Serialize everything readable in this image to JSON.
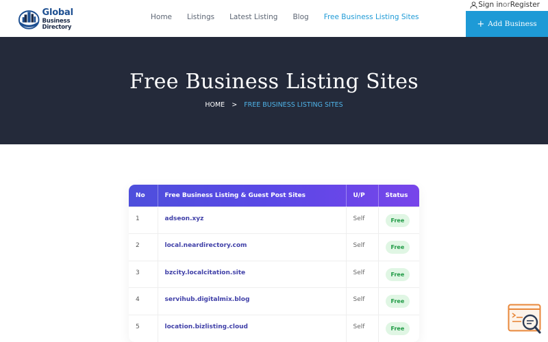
{
  "logo": {
    "line1": "Global",
    "line2": "Business Directory",
    "brand_color": "#1d4f91"
  },
  "nav": {
    "items": [
      {
        "label": "Home",
        "active": false
      },
      {
        "label": "Listings",
        "active": false
      },
      {
        "label": "Latest Listing",
        "active": false
      },
      {
        "label": "Blog",
        "active": false
      },
      {
        "label": "Free Business Listing Sites",
        "active": true
      }
    ],
    "active_color": "#1e9ad6"
  },
  "auth": {
    "sign_in": "Sign in",
    "or": "or",
    "register": "Register",
    "icon": "user-icon"
  },
  "add_business": {
    "icon": "+",
    "label": "Add Business",
    "bg_color": "#1e9ad6"
  },
  "hero": {
    "title": "Free Business Listing Sites",
    "breadcrumb": {
      "home": "HOME",
      "separator": ">",
      "current": "FREE BUSINESS LISTING SITES"
    },
    "bg_color": "#242a3a"
  },
  "table": {
    "headers": [
      "No",
      "Free Business Listing & Guest Post Sites",
      "U/P",
      "Status"
    ],
    "rows": [
      {
        "no": "1",
        "site": "adseon.xyz",
        "up": "Self",
        "status": "Free"
      },
      {
        "no": "2",
        "site": "local.neardirectory.com",
        "up": "Self",
        "status": "Free"
      },
      {
        "no": "3",
        "site": "bzcity.localcitation.site",
        "up": "Self",
        "status": "Free"
      },
      {
        "no": "4",
        "site": "servihub.digitalmix.blog",
        "up": "Self",
        "status": "Free"
      },
      {
        "no": "5",
        "site": "location.bizlisting.cloud",
        "up": "Self",
        "status": "Free"
      }
    ],
    "header_gradient": [
      "#4e4fdc",
      "#7845ea"
    ],
    "badge_color": "#1f9a45"
  },
  "widget": {
    "icon": "search-code-icon"
  }
}
